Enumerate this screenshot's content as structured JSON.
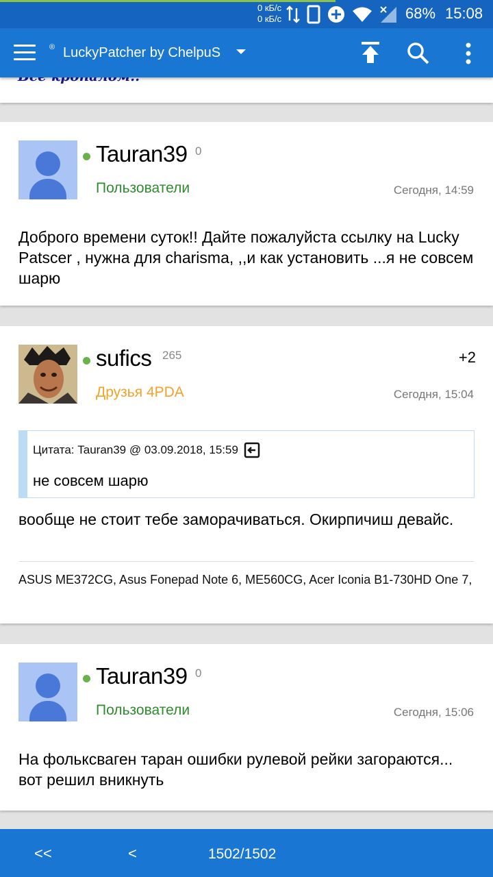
{
  "status": {
    "net_up": "0 кБ/с",
    "net_down": "0 кБ/с",
    "battery": "68%",
    "time": "15:08"
  },
  "appbar": {
    "reg": "®",
    "title": "LuckyPatcher by ChelpuS"
  },
  "prev_strip": {
    "text": "Все кропалом.."
  },
  "posts": [
    {
      "username": "Tauran39",
      "rep": "0",
      "group": "Пользователи",
      "time": "Сегодня, 14:59",
      "text": "Доброго времени суток!! Дайте пожалуйста ссылку на Lucky Patscer , нужна для charisma, ,,и как установить ...я не совсем шарю"
    },
    {
      "username": "sufics",
      "rep": "265",
      "group": "Друзья 4PDA",
      "time": "Сегодня, 15:04",
      "plus": "+2",
      "quote_head": "Цитата: Tauran39 @ 03.09.2018, 15:59",
      "quote_text": "не совсем шарю",
      "text": "вообще не стоит тебе заморачиваться. Окирпичиш девайс.",
      "signature": "ASUS ME372CG, Asus Fonepad Note 6, ME560CG, Acer Iconia B1-730HD One 7,"
    },
    {
      "username": "Tauran39",
      "rep": "0",
      "group": "Пользователи",
      "time": "Сегодня, 15:06",
      "text": "На фольксваген таран ошибки рулевой рейки загораются... вот решил вникнуть"
    }
  ],
  "bottombar": {
    "first": "<<",
    "prev": "<",
    "pages": "1502/1502"
  }
}
